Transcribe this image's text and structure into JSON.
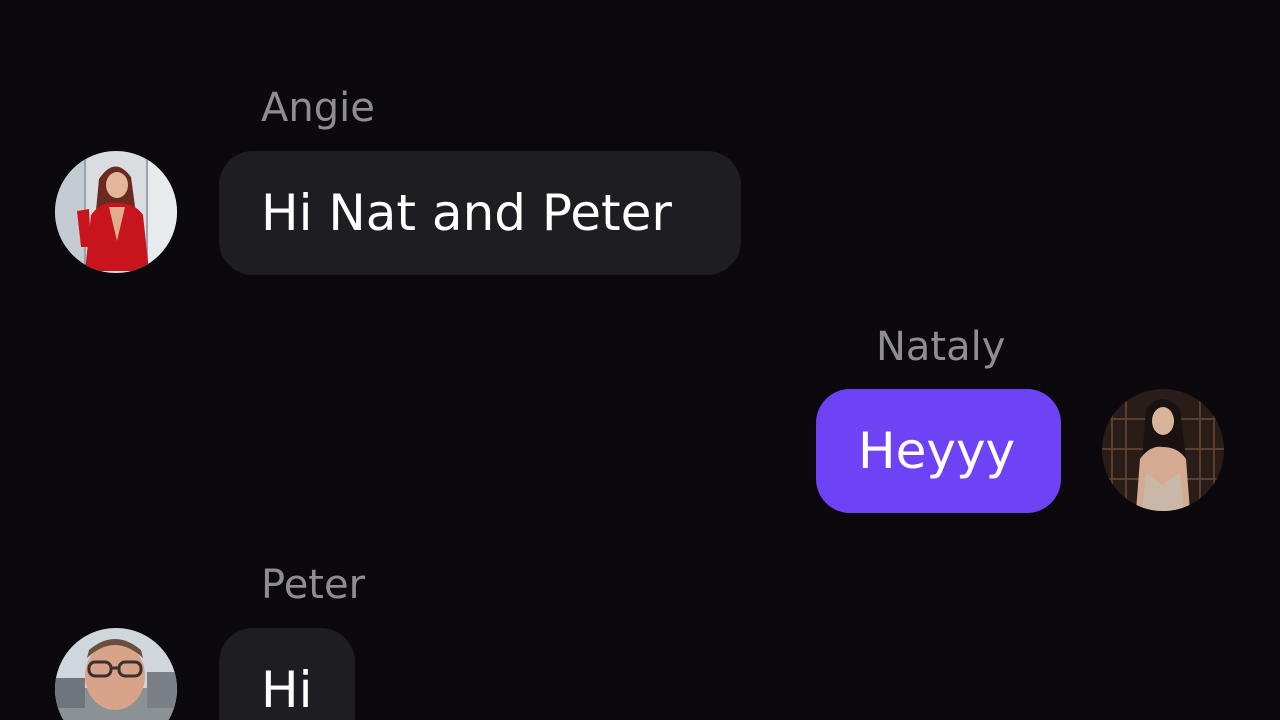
{
  "colors": {
    "background": "#0b090e",
    "incoming_bubble": "#1e1d22",
    "outgoing_bubble": "#6e42f5",
    "sender_name": "#8f8d93",
    "message_text": "#ffffff"
  },
  "messages": [
    {
      "sender": "Angie",
      "text": "Hi Nat and Peter",
      "direction": "incoming",
      "avatar": "angie-avatar"
    },
    {
      "sender": "Nataly",
      "text": "Heyyy",
      "direction": "outgoing",
      "avatar": "nataly-avatar"
    },
    {
      "sender": "Peter",
      "text": "Hi",
      "direction": "incoming",
      "avatar": "peter-avatar"
    }
  ]
}
